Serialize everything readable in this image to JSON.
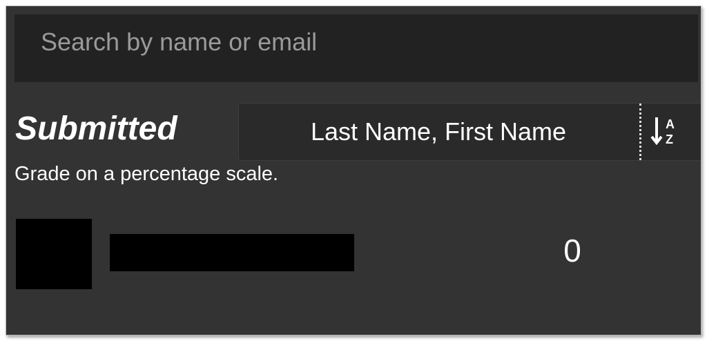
{
  "search": {
    "placeholder": "Search by name or email",
    "value": ""
  },
  "filter": {
    "status_label": "Submitted"
  },
  "sort": {
    "selected": "Last Name, First Name",
    "direction_icon": "sort-alpha-ascending-icon"
  },
  "grading": {
    "note": "Grade on a percentage scale."
  },
  "students": [
    {
      "avatar_redacted": true,
      "name_redacted": true,
      "grade": "0"
    }
  ],
  "colors": {
    "panel_background": "#333333",
    "search_background": "#222222",
    "text": "#ffffff",
    "placeholder": "#9a9a9a"
  }
}
